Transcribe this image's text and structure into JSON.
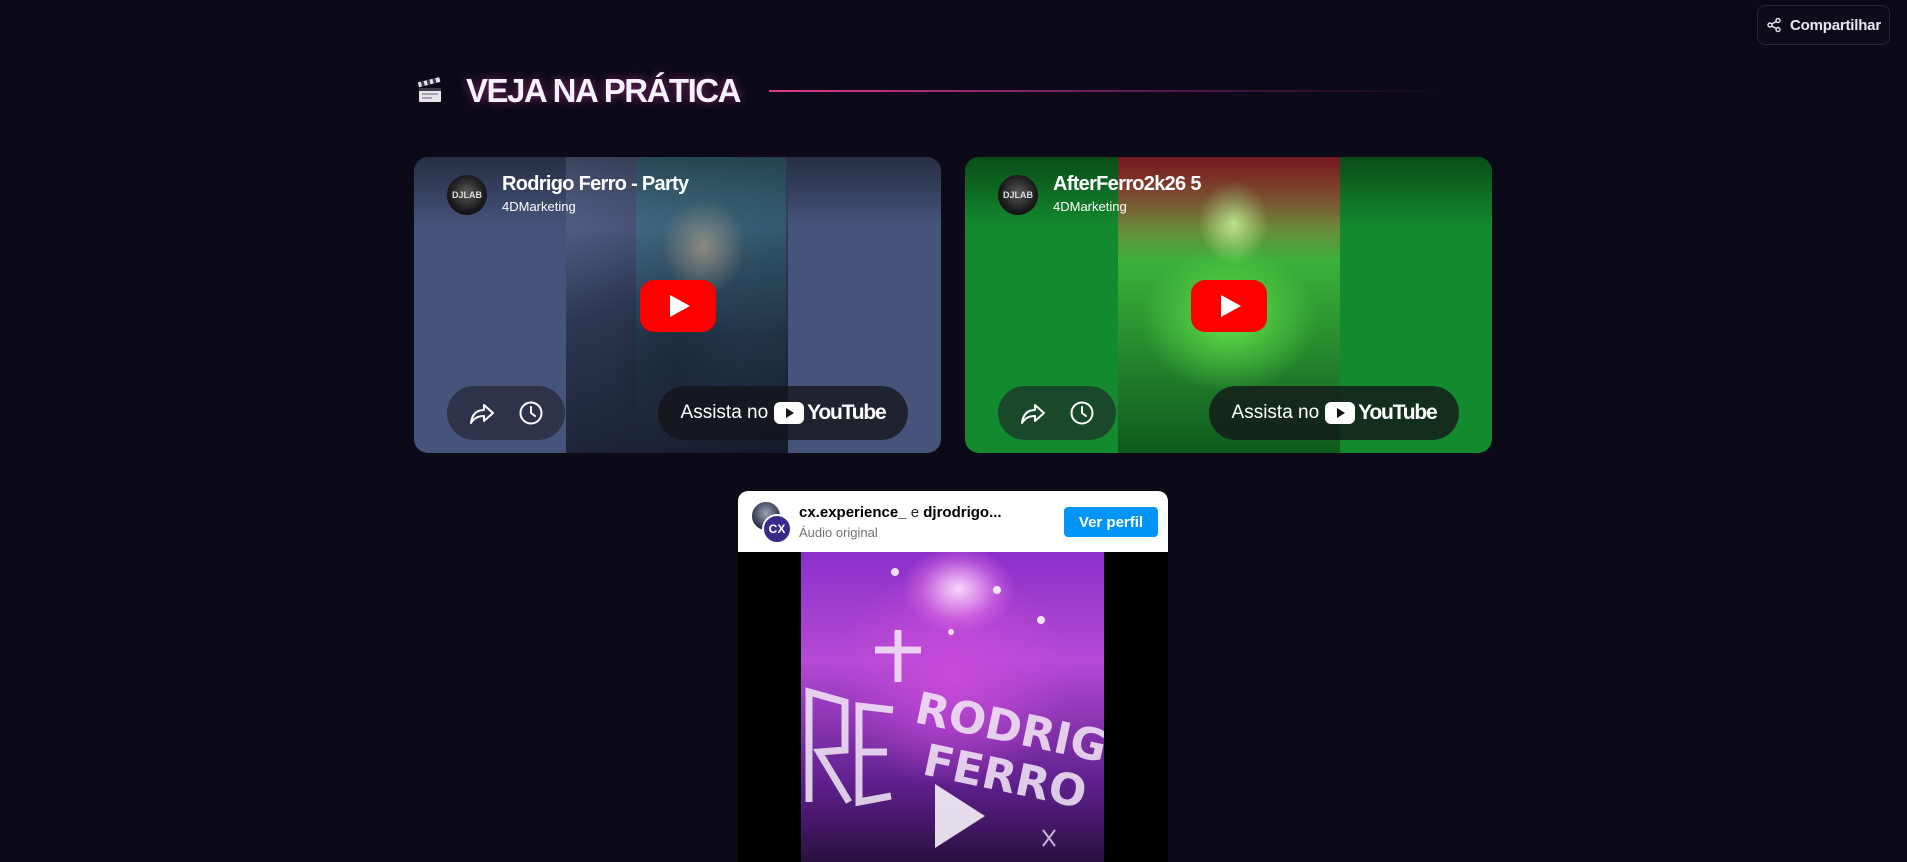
{
  "header": {
    "share_label": "Compartilhar"
  },
  "section": {
    "icon": "clapperboard-icon",
    "title": "VEJA NA PRÁTICA"
  },
  "videos": [
    {
      "title": "Rodrigo Ferro - Party",
      "channel": "4DMarketing",
      "avatar_text": "DJLAB",
      "watch_label": "Assista no",
      "platform": "YouTube",
      "background": "#46547b"
    },
    {
      "title": "AfterFerro2k26 5",
      "channel": "4DMarketing",
      "avatar_text": "DJLAB",
      "watch_label": "Assista no",
      "platform": "YouTube",
      "background": "#138a2e"
    }
  ],
  "instagram": {
    "user1": "cx.experience_",
    "separator": "e",
    "user2": "djrodrigo...",
    "audio": "Áudio original",
    "avatar_text": "CX",
    "follow_label": "Ver perfil",
    "video_text": [
      "RODRIGO",
      "FERRO"
    ]
  },
  "colors": {
    "page_bg": "#0c0a16",
    "accent_line": "#e13a8c",
    "youtube_red": "#ff0000",
    "instagram_blue": "#0095f6"
  }
}
